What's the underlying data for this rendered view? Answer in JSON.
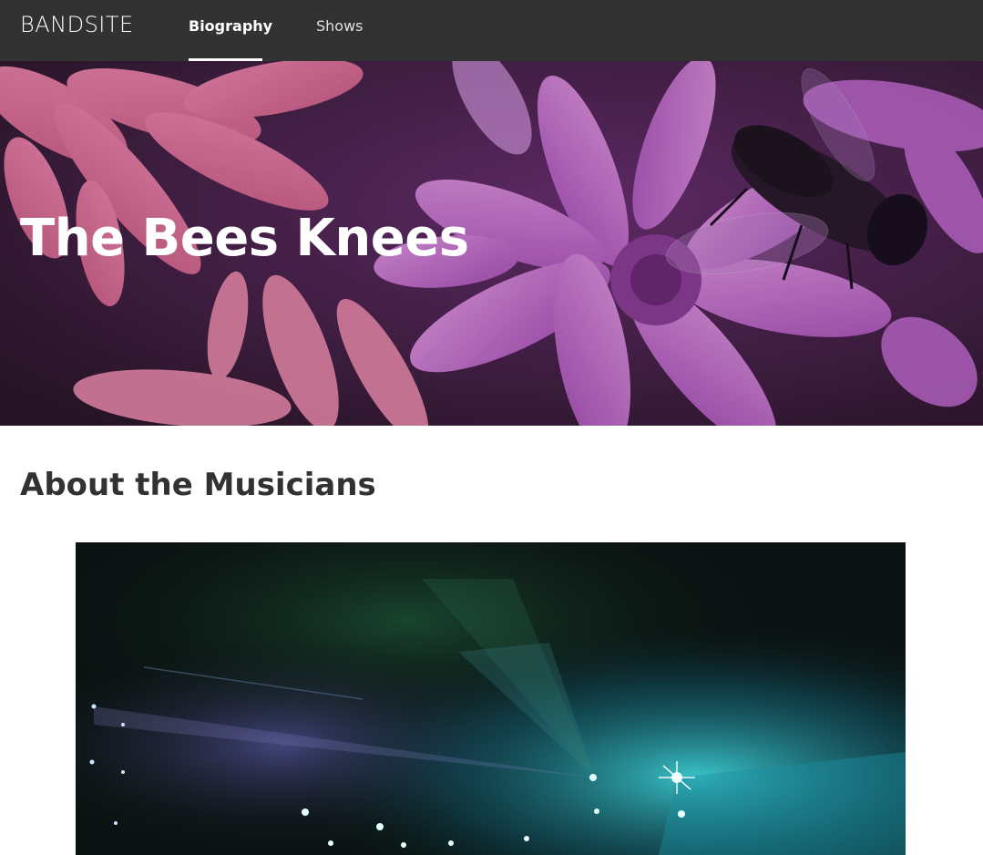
{
  "nav": {
    "logo": "BANDSITE",
    "links": [
      {
        "label": "Biography",
        "active": true
      },
      {
        "label": "Shows",
        "active": false
      }
    ]
  },
  "hero": {
    "title": "The Bees Knees",
    "image": "flower-bee-photo"
  },
  "about": {
    "title": "About the Musicians",
    "image": "concert-lights-photo"
  },
  "colors": {
    "nav_bg": "#323232",
    "text_dark": "#323232",
    "hero_tint": "#a046b4"
  }
}
